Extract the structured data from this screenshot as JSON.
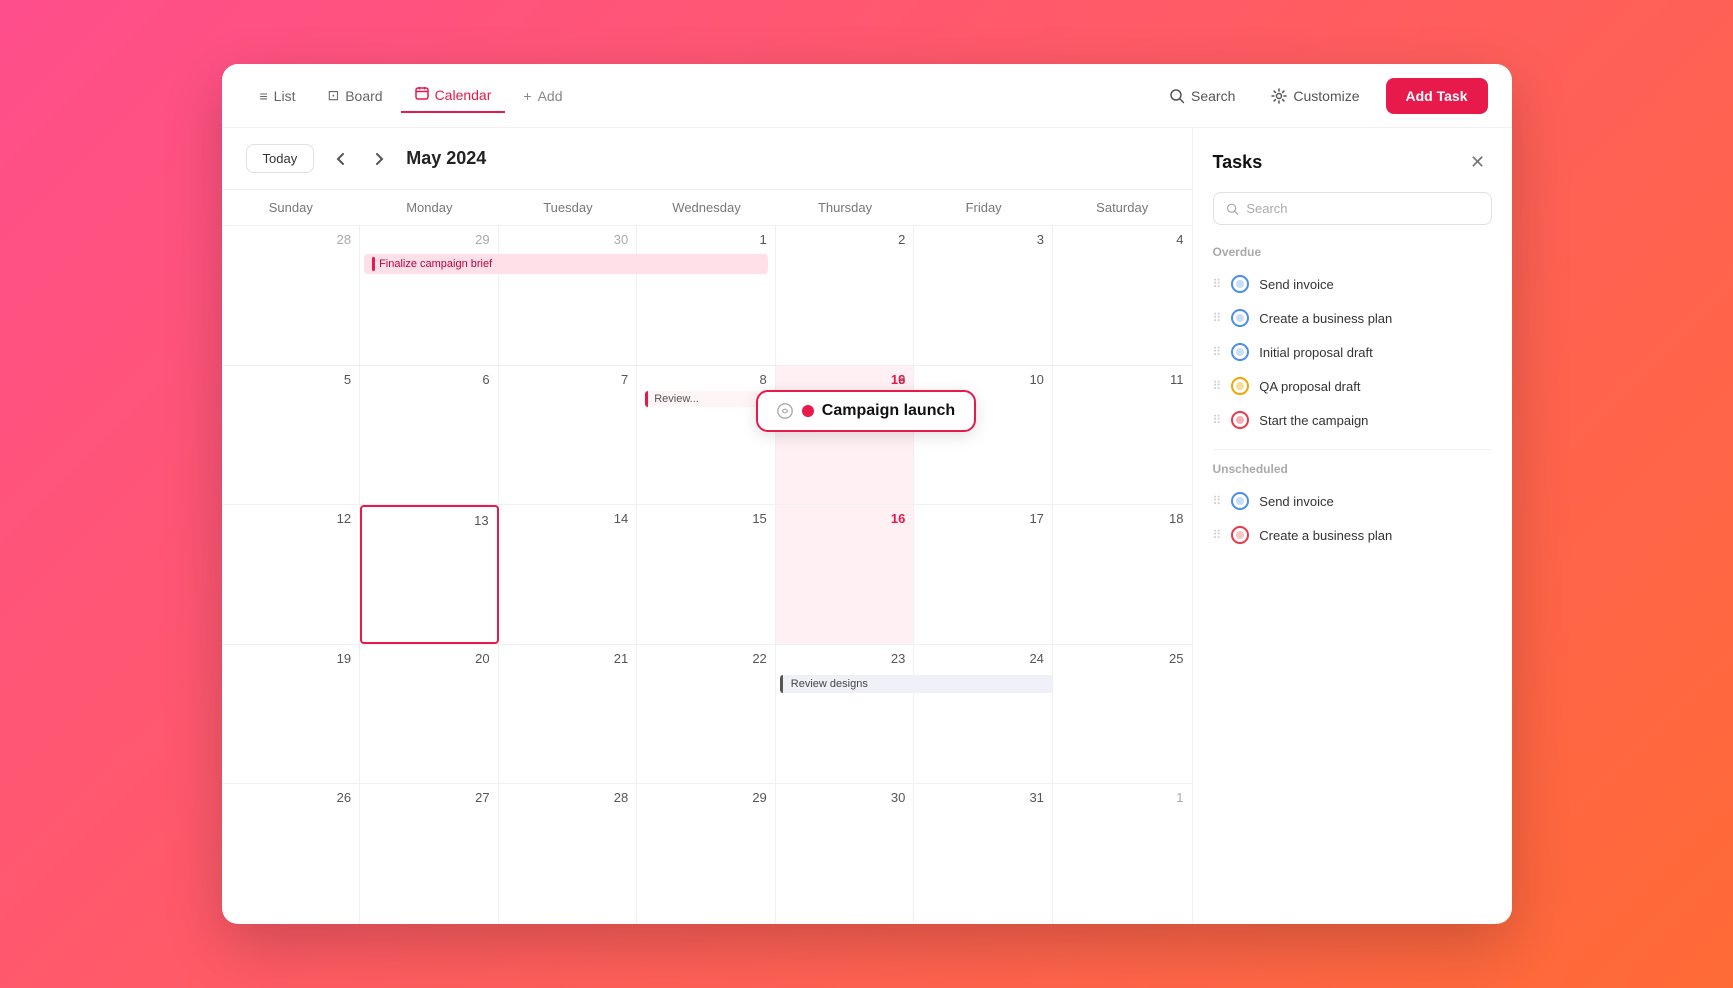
{
  "header": {
    "tabs": [
      {
        "id": "list",
        "label": "List",
        "icon": "≡",
        "active": false
      },
      {
        "id": "board",
        "label": "Board",
        "icon": "⊞",
        "active": false
      },
      {
        "id": "calendar",
        "label": "Calendar",
        "icon": "📅",
        "active": true
      },
      {
        "id": "add",
        "label": "Add",
        "icon": "+",
        "active": false
      }
    ],
    "search_label": "Search",
    "customize_label": "Customize",
    "add_task_label": "Add Task"
  },
  "calendar": {
    "toolbar": {
      "today_label": "Today",
      "month_year": "May 2024"
    },
    "day_headers": [
      "Sunday",
      "Monday",
      "Tuesday",
      "Wednesday",
      "Thursday",
      "Friday",
      "Saturday"
    ],
    "weeks": [
      {
        "days": [
          {
            "date": "28",
            "in_month": false
          },
          {
            "date": "29",
            "in_month": false
          },
          {
            "date": "30",
            "in_month": false
          },
          {
            "date": "1",
            "in_month": true
          },
          {
            "date": "2",
            "in_month": true
          },
          {
            "date": "3",
            "in_month": true
          },
          {
            "date": "4",
            "in_month": true
          }
        ],
        "events": {
          "monday_span": "Finalize campaign brief"
        }
      },
      {
        "days": [
          {
            "date": "5",
            "in_month": true
          },
          {
            "date": "6",
            "in_month": true
          },
          {
            "date": "7",
            "in_month": true
          },
          {
            "date": "8",
            "in_month": true
          },
          {
            "date": "9",
            "in_month": true
          },
          {
            "date": "10",
            "in_month": true
          },
          {
            "date": "11",
            "in_month": true
          }
        ],
        "events": {
          "wednesday_event": "Review...",
          "thursday_popup": "Campaign launch",
          "thursday_plus": true
        }
      },
      {
        "days": [
          {
            "date": "12",
            "in_month": true
          },
          {
            "date": "13",
            "in_month": true,
            "selected": true
          },
          {
            "date": "14",
            "in_month": true
          },
          {
            "date": "15",
            "in_month": true
          },
          {
            "date": "16",
            "in_month": true,
            "today": true
          },
          {
            "date": "17",
            "in_month": true
          },
          {
            "date": "18",
            "in_month": true
          }
        ]
      },
      {
        "days": [
          {
            "date": "19",
            "in_month": true
          },
          {
            "date": "20",
            "in_month": true
          },
          {
            "date": "21",
            "in_month": true
          },
          {
            "date": "22",
            "in_month": true
          },
          {
            "date": "23",
            "in_month": true
          },
          {
            "date": "24",
            "in_month": true
          },
          {
            "date": "25",
            "in_month": true
          }
        ],
        "events": {
          "wednesday_event": "Review designs"
        }
      },
      {
        "days": [
          {
            "date": "26",
            "in_month": true
          },
          {
            "date": "27",
            "in_month": true
          },
          {
            "date": "28",
            "in_month": true
          },
          {
            "date": "29",
            "in_month": true
          },
          {
            "date": "30",
            "in_month": true
          },
          {
            "date": "31",
            "in_month": true
          },
          {
            "date": "1",
            "in_month": false
          }
        ]
      }
    ]
  },
  "tasks_panel": {
    "title": "Tasks",
    "search_placeholder": "Search",
    "overdue_label": "Overdue",
    "overdue_tasks": [
      {
        "id": 1,
        "name": "Send invoice",
        "icon_type": "blue"
      },
      {
        "id": 2,
        "name": "Create a business plan",
        "icon_type": "blue"
      },
      {
        "id": 3,
        "name": "Initial proposal draft",
        "icon_type": "blue"
      },
      {
        "id": 4,
        "name": "QA proposal draft",
        "icon_type": "yellow"
      },
      {
        "id": 5,
        "name": "Start the campaign",
        "icon_type": "red"
      }
    ],
    "unscheduled_label": "Unscheduled",
    "unscheduled_tasks": [
      {
        "id": 6,
        "name": "Send invoice",
        "icon_type": "blue"
      },
      {
        "id": 7,
        "name": "Create a business plan",
        "icon_type": "pink"
      }
    ]
  }
}
